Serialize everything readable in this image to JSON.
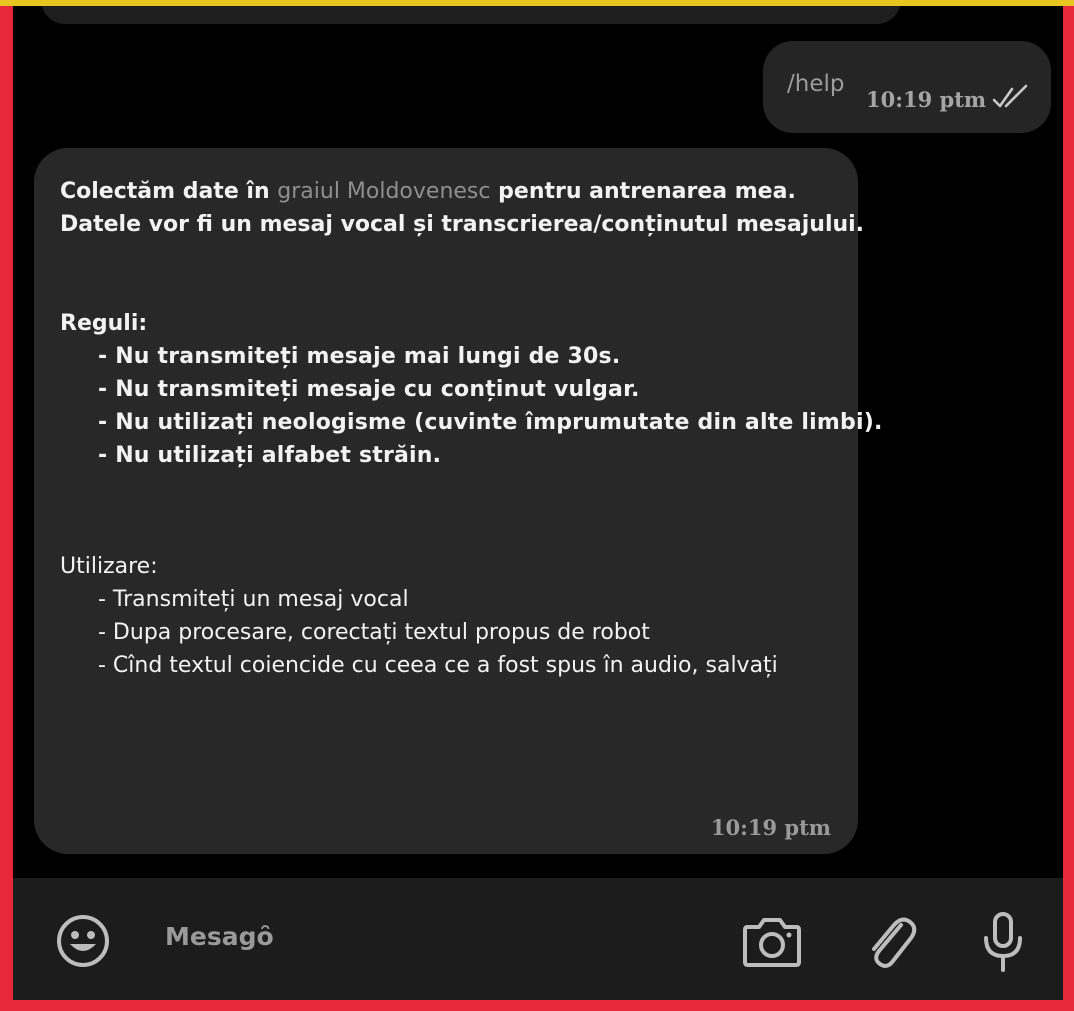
{
  "outgoing": {
    "text": "/help",
    "time": "10:19 ptm",
    "status_icon": "double-check-icon"
  },
  "incoming": {
    "intro_before": "Colectăm date în ",
    "intro_highlight": "graiul Moldovenesc",
    "intro_after": " pentru antrenarea mea.",
    "intro_line2": "Datele vor fi un mesaj vocal și transcrierea/conținutul mesajului.",
    "rules_title": "Reguli:",
    "rules": [
      "- Nu transmiteți mesaje mai lungi de 30s.",
      "- Nu transmiteți mesaje cu conținut vulgar.",
      "- Nu utilizați neologisme (cuvinte împrumutate din alte limbi).",
      "- Nu utilizați alfabet străin."
    ],
    "usage_title": "Utilizare:",
    "usage": [
      "- Transmiteți un mesaj vocal",
      "- Dupa procesare, corectați textul propus de robot",
      "- Cînd textul coiencide cu ceea ce a fost spus în audio, salvați"
    ],
    "time": "10:19 ptm"
  },
  "composer": {
    "placeholder": "Mesagȏ",
    "icons": [
      "emoji-icon",
      "camera-icon",
      "attach-icon",
      "microphone-icon"
    ]
  },
  "colors": {
    "outer_top": "#e8c521",
    "frame": "#e8283a",
    "chat_bg": "#000000",
    "bubble_bg": "#282828",
    "composer_bg": "#1c1c1c"
  }
}
